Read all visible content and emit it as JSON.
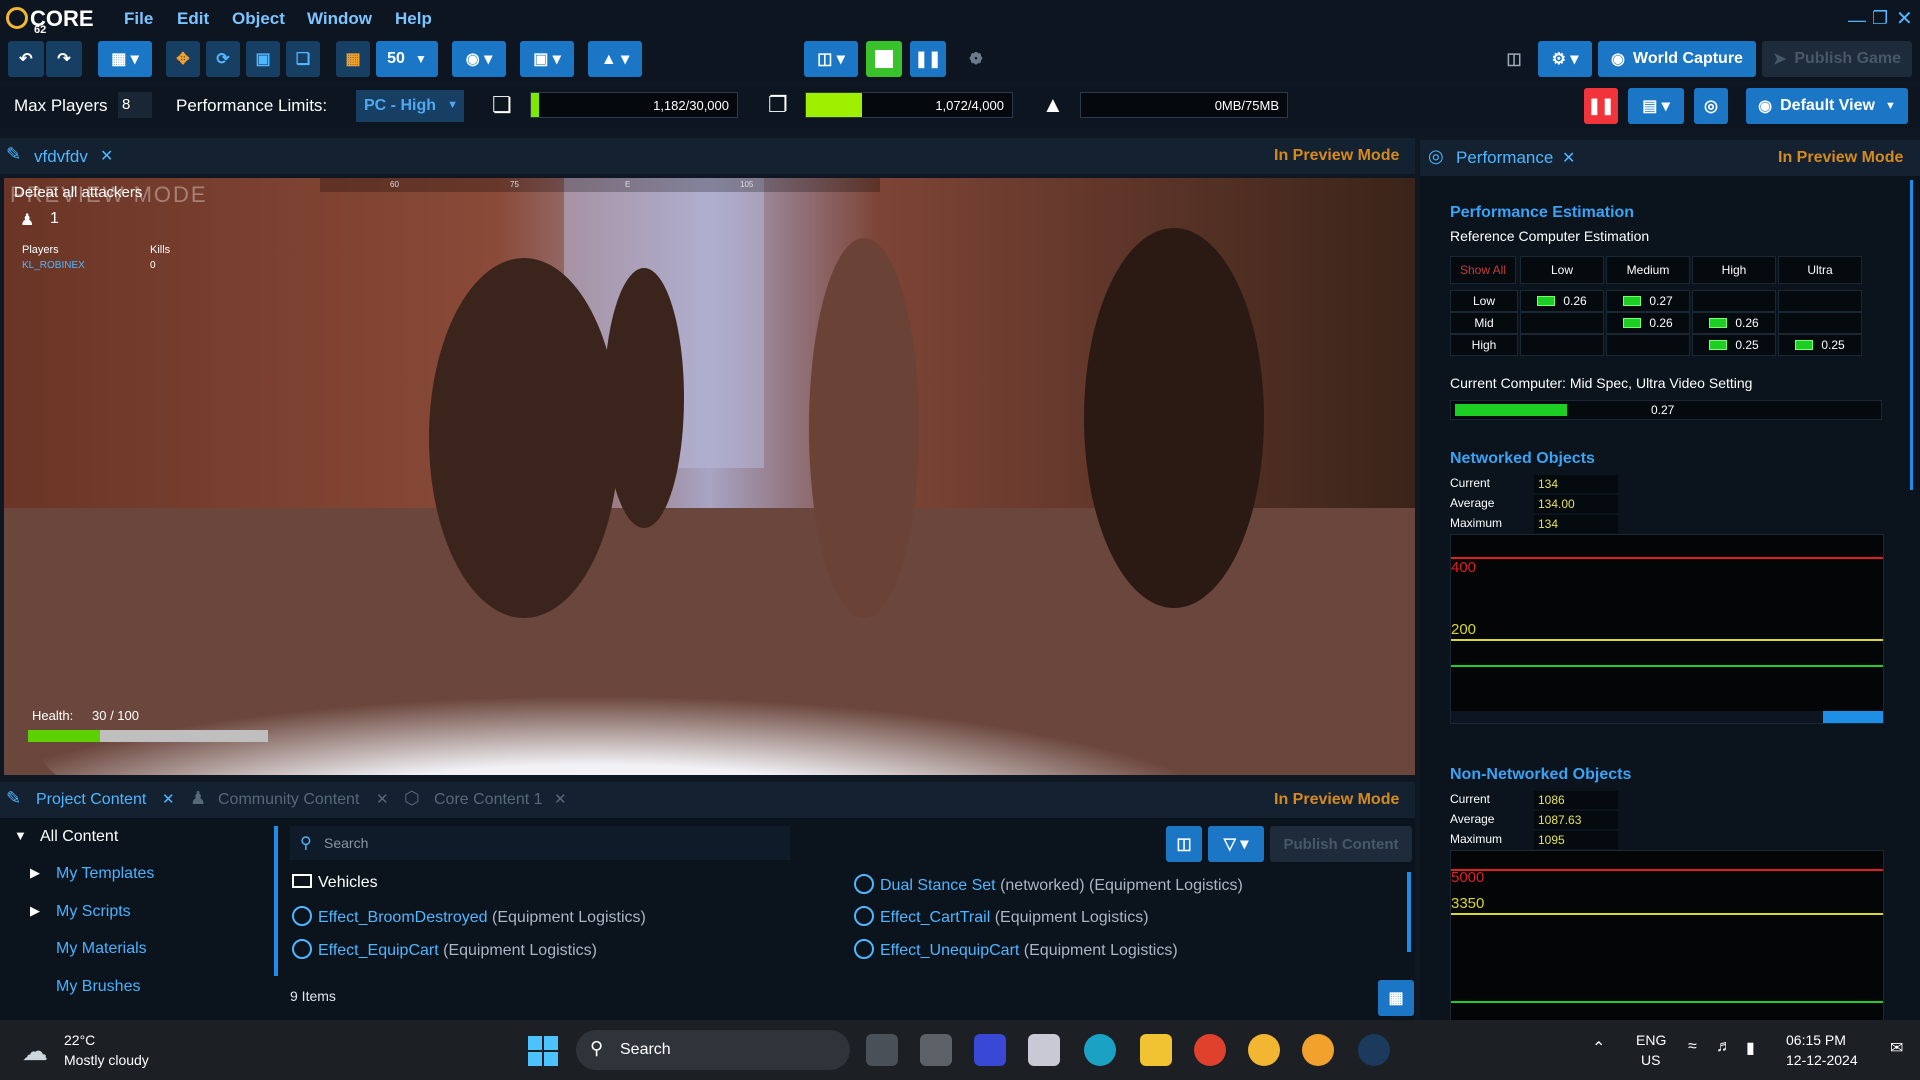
{
  "app": {
    "logo_text": "CORE",
    "logo_sub": "62"
  },
  "menu": [
    "File",
    "Edit",
    "Object",
    "Window",
    "Help"
  ],
  "toolbar": {
    "grid_size": "50",
    "world_capture": "World Capture",
    "publish_game": "Publish Game"
  },
  "perf": {
    "max_players_label": "Max Players",
    "max_players_value": "8",
    "limits_label": "Performance Limits:",
    "limits_value": "PC - High",
    "objects_meter": "1,182/30,000",
    "objects_fraction": 0.04,
    "networked_meter": "1,072/4,000",
    "networked_fraction": 0.27,
    "memory_meter": "0MB/75MB",
    "memory_fraction": 0,
    "default_view": "Default View"
  },
  "viewport_tab": {
    "title": "vfdvfdv",
    "mode": "In Preview Mode"
  },
  "hud": {
    "objective": "Defeat all attackers",
    "watermark": "PREVIEW MODE",
    "team_count": "1",
    "players_label": "Players",
    "kills_label": "Kills",
    "player_name": "KL_ROBINEX",
    "kills_value": "0",
    "health_label": "Health:",
    "health_value": "30 / 100",
    "health_fraction": 0.3,
    "ruler": [
      "60",
      "75",
      "E",
      "105"
    ]
  },
  "performance_panel": {
    "tab": "Performance",
    "mode": "In Preview Mode",
    "estimation_title": "Performance Estimation",
    "estimation_sub": "Reference Computer Estimation",
    "show_all": "Show All",
    "cols": [
      "Low",
      "Medium",
      "High",
      "Ultra"
    ],
    "rows": [
      {
        "label": "Low",
        "cells": [
          "0.26",
          "0.27",
          "",
          ""
        ]
      },
      {
        "label": "Mid",
        "cells": [
          "",
          "0.26",
          "0.26",
          ""
        ]
      },
      {
        "label": "High",
        "cells": [
          "",
          "",
          "0.25",
          "0.25"
        ]
      }
    ],
    "current_computer": "Current Computer: Mid Spec, Ultra Video Setting",
    "current_value": "0.27",
    "current_fraction": 0.27,
    "networked": {
      "title": "Networked Objects",
      "current_label": "Current",
      "current": "134",
      "average_label": "Average",
      "average": "134.00",
      "maximum_label": "Maximum",
      "maximum": "134",
      "line_high": "400",
      "line_mid": "200"
    },
    "non_networked": {
      "title": "Non-Networked Objects",
      "current_label": "Current",
      "current": "1086",
      "average_label": "Average",
      "average": "1087.63",
      "maximum_label": "Maximum",
      "maximum": "1095",
      "line_high": "5000",
      "line_mid": "3350"
    }
  },
  "content": {
    "tabs": [
      "Project Content",
      "Community Content",
      "Core Content 1"
    ],
    "mode": "In Preview Mode",
    "tree_root": "All Content",
    "tree": [
      "My Templates",
      "My Scripts",
      "My Materials",
      "My Brushes"
    ],
    "search_placeholder": "Search",
    "publish_content": "Publish Content",
    "folder": "Vehicles",
    "items_left": [
      {
        "name": "Effect_BroomDestroyed",
        "suffix": "(Equipment Logistics)"
      },
      {
        "name": "Effect_EquipCart",
        "suffix": "(Equipment Logistics)"
      }
    ],
    "items_right": [
      {
        "name": "Dual Stance Set",
        "suffix": "(networked) (Equipment Logistics)"
      },
      {
        "name": "Effect_CartTrail",
        "suffix": "(Equipment Logistics)"
      },
      {
        "name": "Effect_UnequipCart",
        "suffix": "(Equipment Logistics)"
      }
    ],
    "count": "9 Items"
  },
  "taskbar": {
    "temp": "22°C",
    "weather": "Mostly cloudy",
    "search": "Search",
    "lang": "ENG",
    "region": "US",
    "time": "06:15 PM",
    "date": "12-12-2024"
  }
}
